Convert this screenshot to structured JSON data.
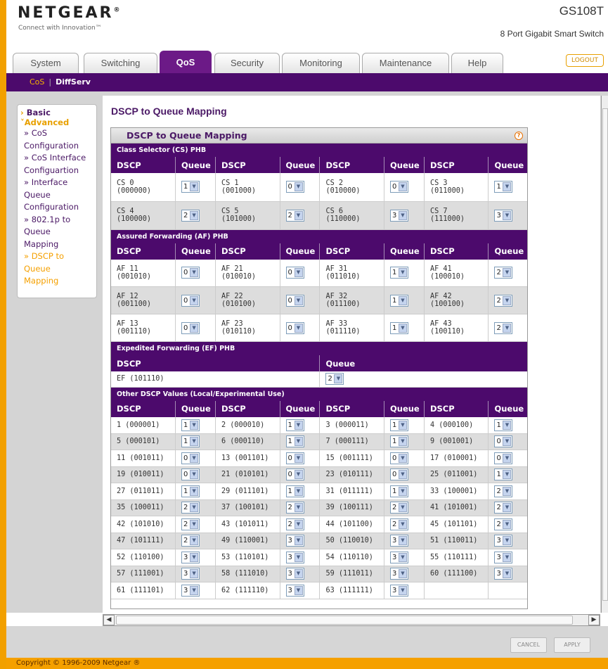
{
  "brand": {
    "logo": "NETGEAR",
    "tagline": "Connect with Innovation™",
    "model": "GS108T",
    "model_desc": "8 Port Gigabit Smart Switch"
  },
  "tabs": [
    "System",
    "Switching",
    "QoS",
    "Security",
    "Monitoring",
    "Maintenance",
    "Help"
  ],
  "logout": "LOGOUT",
  "subnav": {
    "cos": "CoS",
    "diffserv": "DiffServ"
  },
  "sidebar": {
    "basic": "Basic",
    "advanced": "Advanced",
    "items": [
      "» CoS",
      "Configuration",
      "» CoS Interface",
      "Configuartion",
      "» Interface",
      "Queue",
      "Configuration",
      "» 802.1p to",
      "Queue",
      "Mapping",
      "» DSCP to",
      "Queue",
      "Mapping"
    ]
  },
  "page_title": "DSCP to Queue Mapping",
  "panel_title": "DSCP to Queue Mapping",
  "help_icon": "?",
  "headers": {
    "dscp": "DSCP",
    "queue": "Queue"
  },
  "sections": {
    "cs": "Class Selector (CS) PHB",
    "af": "Assured Forwarding (AF) PHB",
    "ef": "Expedited Forwarding (EF) PHB",
    "other": "Other DSCP Values (Local/Experimental Use)"
  },
  "cs_rows": [
    [
      {
        "n": "CS 0",
        "b": "(000000)",
        "q": "1"
      },
      {
        "n": "CS 1",
        "b": "(001000)",
        "q": "0"
      },
      {
        "n": "CS 2",
        "b": "(010000)",
        "q": "0"
      },
      {
        "n": "CS 3",
        "b": "(011000)",
        "q": "1"
      }
    ],
    [
      {
        "n": "CS 4",
        "b": "(100000)",
        "q": "2"
      },
      {
        "n": "CS 5",
        "b": "(101000)",
        "q": "2"
      },
      {
        "n": "CS 6",
        "b": "(110000)",
        "q": "3"
      },
      {
        "n": "CS 7",
        "b": "(111000)",
        "q": "3"
      }
    ]
  ],
  "af_rows": [
    [
      {
        "n": "AF 11",
        "b": "(001010)",
        "q": "0"
      },
      {
        "n": "AF 21",
        "b": "(010010)",
        "q": "0"
      },
      {
        "n": "AF 31",
        "b": "(011010)",
        "q": "1"
      },
      {
        "n": "AF 41",
        "b": "(100010)",
        "q": "2"
      }
    ],
    [
      {
        "n": "AF 12",
        "b": "(001100)",
        "q": "0"
      },
      {
        "n": "AF 22",
        "b": "(010100)",
        "q": "0"
      },
      {
        "n": "AF 32",
        "b": "(011100)",
        "q": "1"
      },
      {
        "n": "AF 42",
        "b": "(100100)",
        "q": "2"
      }
    ],
    [
      {
        "n": "AF 13",
        "b": "(001110)",
        "q": "0"
      },
      {
        "n": "AF 23",
        "b": "(010110)",
        "q": "0"
      },
      {
        "n": "AF 33",
        "b": "(011110)",
        "q": "1"
      },
      {
        "n": "AF 43",
        "b": "(100110)",
        "q": "2"
      }
    ]
  ],
  "ef": {
    "dscp": "EF (101110)",
    "q": "2"
  },
  "other_rows": [
    [
      {
        "d": "1 (000001)",
        "q": "1"
      },
      {
        "d": "2 (000010)",
        "q": "1"
      },
      {
        "d": "3 (000011)",
        "q": "1"
      },
      {
        "d": "4 (000100)",
        "q": "1"
      }
    ],
    [
      {
        "d": "5 (000101)",
        "q": "1"
      },
      {
        "d": "6 (000110)",
        "q": "1"
      },
      {
        "d": "7 (000111)",
        "q": "1"
      },
      {
        "d": "9 (001001)",
        "q": "0"
      }
    ],
    [
      {
        "d": "11 (001011)",
        "q": "0"
      },
      {
        "d": "13 (001101)",
        "q": "0"
      },
      {
        "d": "15 (001111)",
        "q": "0"
      },
      {
        "d": "17 (010001)",
        "q": "0"
      }
    ],
    [
      {
        "d": "19 (010011)",
        "q": "0"
      },
      {
        "d": "21 (010101)",
        "q": "0"
      },
      {
        "d": "23 (010111)",
        "q": "0"
      },
      {
        "d": "25 (011001)",
        "q": "1"
      }
    ],
    [
      {
        "d": "27 (011011)",
        "q": "1"
      },
      {
        "d": "29 (011101)",
        "q": "1"
      },
      {
        "d": "31 (011111)",
        "q": "1"
      },
      {
        "d": "33 (100001)",
        "q": "2"
      }
    ],
    [
      {
        "d": "35 (100011)",
        "q": "2"
      },
      {
        "d": "37 (100101)",
        "q": "2"
      },
      {
        "d": "39 (100111)",
        "q": "2"
      },
      {
        "d": "41 (101001)",
        "q": "2"
      }
    ],
    [
      {
        "d": "42 (101010)",
        "q": "2"
      },
      {
        "d": "43 (101011)",
        "q": "2"
      },
      {
        "d": "44 (101100)",
        "q": "2"
      },
      {
        "d": "45 (101101)",
        "q": "2"
      }
    ],
    [
      {
        "d": "47 (101111)",
        "q": "2"
      },
      {
        "d": "49 (110001)",
        "q": "3"
      },
      {
        "d": "50 (110010)",
        "q": "3"
      },
      {
        "d": "51 (110011)",
        "q": "3"
      }
    ],
    [
      {
        "d": "52 (110100)",
        "q": "3"
      },
      {
        "d": "53 (110101)",
        "q": "3"
      },
      {
        "d": "54 (110110)",
        "q": "3"
      },
      {
        "d": "55 (110111)",
        "q": "3"
      }
    ],
    [
      {
        "d": "57 (111001)",
        "q": "3"
      },
      {
        "d": "58 (111010)",
        "q": "3"
      },
      {
        "d": "59 (111011)",
        "q": "3"
      },
      {
        "d": "60 (111100)",
        "q": "3"
      }
    ],
    [
      {
        "d": "61 (111101)",
        "q": "3"
      },
      {
        "d": "62 (111110)",
        "q": "3"
      },
      {
        "d": "63 (111111)",
        "q": "3"
      }
    ]
  ],
  "buttons": {
    "cancel": "CANCEL",
    "apply": "APPLY"
  },
  "copyright": "Copyright © 1996-2009 Netgear ®",
  "colors": {
    "purple": "#4c0a6c",
    "orange": "#f5a000"
  }
}
